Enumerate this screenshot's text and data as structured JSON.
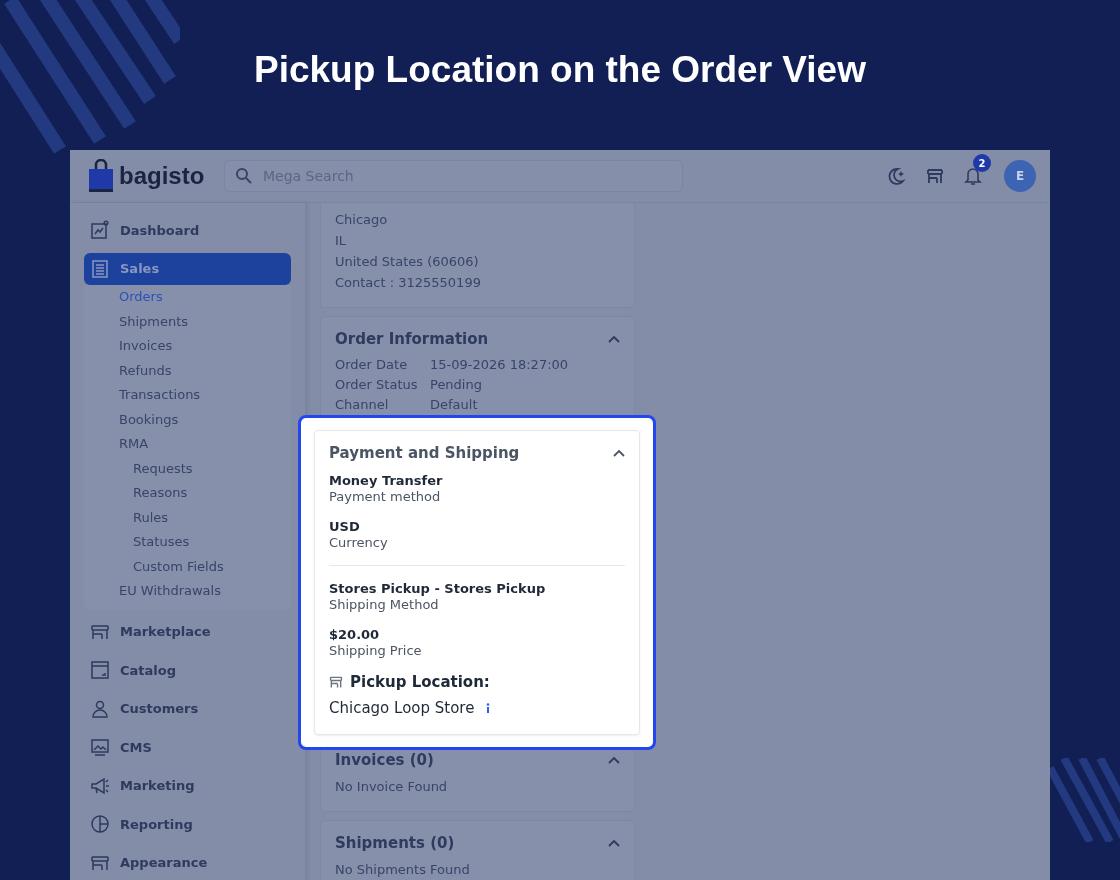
{
  "page_title": "Pickup Location on the Order View",
  "topbar": {
    "logo_text": "bagisto",
    "search": {
      "placeholder": "Mega Search"
    },
    "notification_count": "2",
    "avatar_initial": "E"
  },
  "sidebar": {
    "items": [
      {
        "label": "Dashboard",
        "selected": false
      },
      {
        "label": "Sales",
        "selected": true,
        "children": [
          {
            "label": "Orders",
            "selected": true
          },
          {
            "label": "Shipments",
            "selected": false
          },
          {
            "label": "Invoices",
            "selected": false
          },
          {
            "label": "Refunds",
            "selected": false
          },
          {
            "label": "Transactions",
            "selected": false
          },
          {
            "label": "Bookings",
            "selected": false
          },
          {
            "label": "RMA",
            "selected": false,
            "children": [
              {
                "label": "Requests",
                "selected": false
              },
              {
                "label": "Reasons",
                "selected": false
              },
              {
                "label": "Rules",
                "selected": false
              },
              {
                "label": "Statuses",
                "selected": false
              },
              {
                "label": "Custom Fields",
                "selected": false
              }
            ]
          },
          {
            "label": "EU Withdrawals",
            "selected": false
          }
        ]
      },
      {
        "label": "Marketplace",
        "selected": false
      },
      {
        "label": "Catalog",
        "selected": false
      },
      {
        "label": "Customers",
        "selected": false
      },
      {
        "label": "CMS",
        "selected": false
      },
      {
        "label": "Marketing",
        "selected": false
      },
      {
        "label": "Reporting",
        "selected": false
      },
      {
        "label": "Appearance",
        "selected": false
      }
    ]
  },
  "address_lines": [
    "Chicago",
    "IL",
    "United States (60606)",
    "Contact : 3125550199"
  ],
  "order_information": {
    "title": "Order Information",
    "rows": [
      {
        "label": "Order Date",
        "value": "15-09-2026 18:27:00"
      },
      {
        "label": "Order Status",
        "value": "Pending"
      },
      {
        "label": "Channel",
        "value": "Default"
      }
    ]
  },
  "payment_and_shipping": {
    "title": "Payment and Shipping",
    "payment": [
      {
        "value": "Money Transfer",
        "label": "Payment method"
      },
      {
        "value": "USD",
        "label": "Currency"
      }
    ],
    "shipping": [
      {
        "value": "Stores Pickup - Stores Pickup",
        "label": "Shipping Method"
      },
      {
        "value": "$20.00",
        "label": "Shipping Price"
      }
    ],
    "pickup_location": {
      "heading": "Pickup Location:",
      "store": "Chicago Loop Store"
    }
  },
  "invoices": {
    "title": "Invoices (0)",
    "empty_text": "No Invoice Found"
  },
  "shipments": {
    "title": "Shipments (0)",
    "empty_text": "No Shipments Found"
  }
}
